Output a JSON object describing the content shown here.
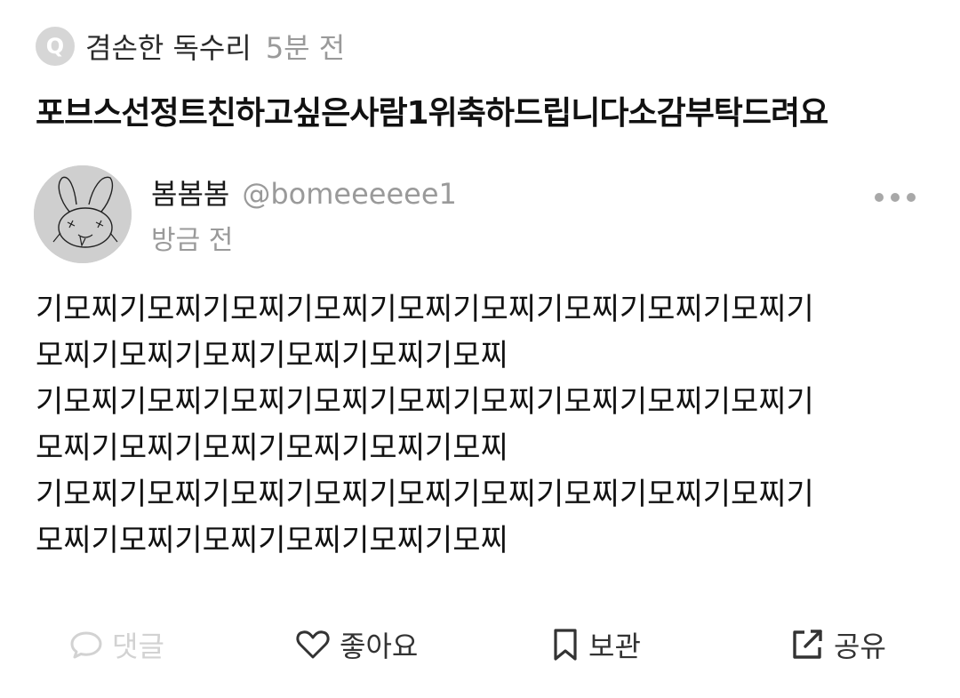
{
  "question": {
    "badge": "Q",
    "asker": "겸손한 독수리",
    "time": "5분 전",
    "title": "포브스선정트친하고싶은사람1위축하드립니다소감부탁드려요"
  },
  "answer": {
    "author_name": "봄봄봄",
    "author_handle": "@bomeeeeee1",
    "time": "방금 전",
    "lines": [
      "기모찌기모찌기모찌기모찌기모찌기모찌기모찌기모찌기모찌기",
      "모찌기모찌기모찌기모찌기모찌기모찌",
      "기모찌기모찌기모찌기모찌기모찌기모찌기모찌기모찌기모찌기",
      "모찌기모찌기모찌기모찌기모찌기모찌",
      "기모찌기모찌기모찌기모찌기모찌기모찌기모찌기모찌기모찌기",
      "모찌기모찌기모찌기모찌기모찌기모찌"
    ]
  },
  "actions": {
    "comment": "댓글",
    "like": "좋아요",
    "save": "보관",
    "share": "공유"
  },
  "icons": {
    "badge": "q-badge-icon",
    "avatar": "rabbit-doodle-avatar",
    "more": "more-dots-icon",
    "comment": "speech-bubble-icon",
    "like": "heart-icon",
    "save": "bookmark-icon",
    "share": "external-share-icon"
  },
  "colors": {
    "text": "#111111",
    "muted": "#9a9a9a",
    "disabled": "#d2d2d2",
    "badge_bg": "#d6d6d6"
  }
}
